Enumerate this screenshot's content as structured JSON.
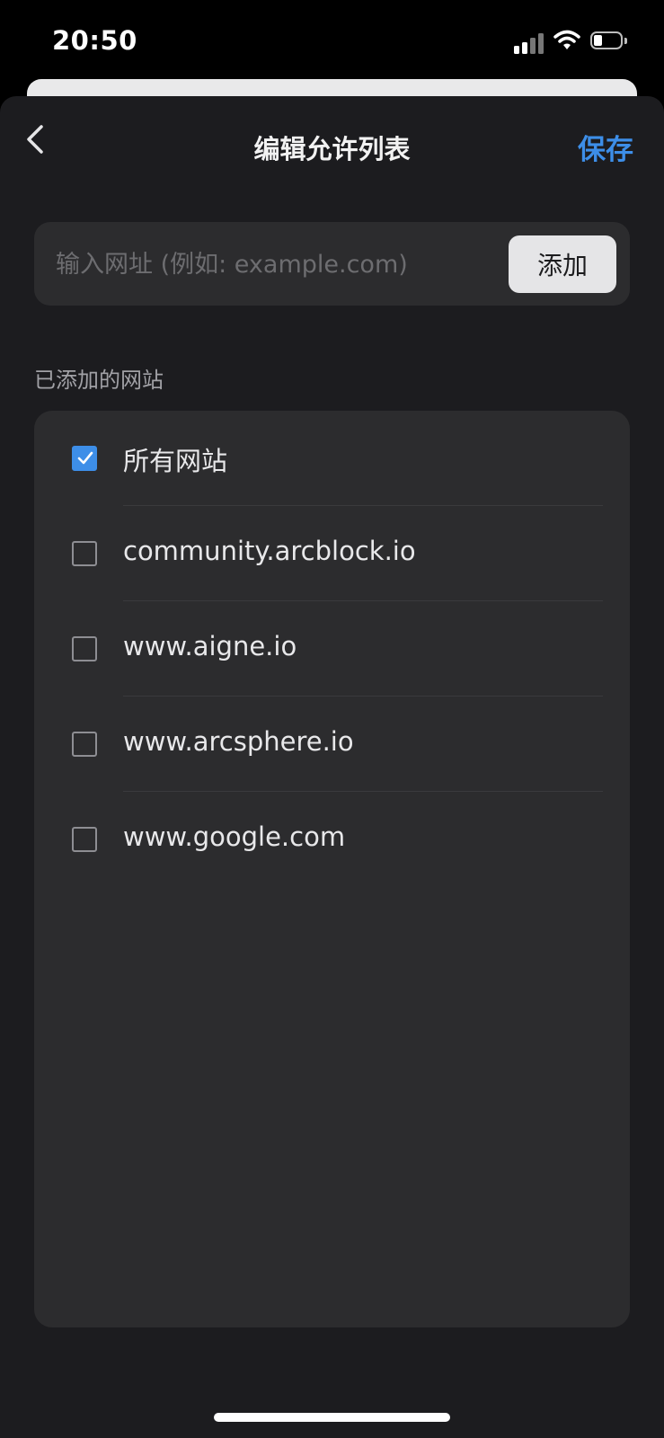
{
  "status_bar": {
    "time": "20:50"
  },
  "nav": {
    "title": "编辑允许列表",
    "save_label": "保存",
    "back_icon": "chevron-left-icon"
  },
  "add_site": {
    "placeholder": "输入网址 (例如: example.com)",
    "value": "",
    "add_label": "添加"
  },
  "section_label": "已添加的网站",
  "sites": [
    {
      "label": "所有网站",
      "checked": true
    },
    {
      "label": "community.arcblock.io",
      "checked": false
    },
    {
      "label": "www.aigne.io",
      "checked": false
    },
    {
      "label": "www.arcsphere.io",
      "checked": false
    },
    {
      "label": "www.google.com",
      "checked": false
    }
  ],
  "colors": {
    "accent": "#3d8ee8",
    "background": "#1c1c1f",
    "card": "#2c2c2e"
  }
}
